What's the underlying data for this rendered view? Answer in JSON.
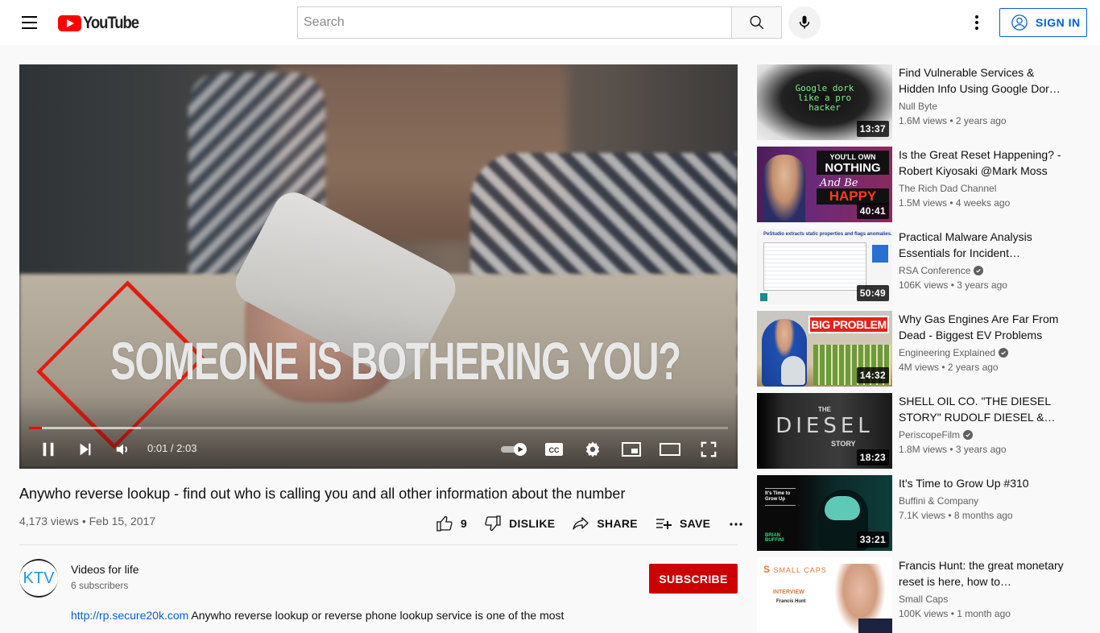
{
  "header": {
    "logo_text": "YouTube",
    "search_placeholder": "Search",
    "signin_label": "SIGN IN",
    "icons": [
      "menu-icon",
      "search-icon",
      "microphone-icon",
      "more-vert-icon",
      "account-circle-icon"
    ]
  },
  "player": {
    "overlay_text": "SOMEONE IS BOTHERING YOU?",
    "current_time": "0:01",
    "duration": "2:03",
    "time_display": "0:01 / 2:03",
    "progress_played_fraction": 0.008,
    "progress_loaded_fraction": 0.16,
    "autoplay_on": true,
    "icons": [
      "pause-icon",
      "next-icon",
      "volume-icon",
      "autoplay-toggle-icon",
      "captions-icon",
      "settings-icon",
      "miniplayer-icon",
      "theater-icon",
      "fullscreen-icon"
    ]
  },
  "video": {
    "title": "Anywho reverse lookup - find out who is calling you and all other information about the number",
    "views": "4,173 views",
    "date": "Feb 15, 2017",
    "meta": "4,173 views • Feb 15, 2017",
    "actions": {
      "like_count": "9",
      "dislike_label": "DISLIKE",
      "share_label": "SHARE",
      "save_label": "SAVE"
    }
  },
  "channel": {
    "avatar_text": "KTV",
    "name": "Videos for life",
    "subscribers": "6 subscribers",
    "subscribe_label": "SUBSCRIBE"
  },
  "description": {
    "link": "http://rp.secure20k.com",
    "text": " Anywho reverse lookup or reverse phone lookup service is one of the most"
  },
  "colors": {
    "brand_red": "#ff0000",
    "subscribe_red": "#cc0000",
    "link_blue": "#065fd4",
    "secondary_text": "#606060"
  },
  "recommendations": [
    {
      "title": "Find Vulnerable Services & Hidden Info Using Google Dor…",
      "channel": "Null Byte",
      "verified": false,
      "meta": "1.6M views • 2 years ago",
      "duration": "13:37",
      "thumb_text": "Google dork like a pro hacker"
    },
    {
      "title": "Is the Great Reset Happening? - Robert Kiyosaki @Mark Moss",
      "channel": "The Rich Dad Channel",
      "verified": false,
      "meta": "1.5M views • 4 weeks ago",
      "duration": "40:41",
      "thumb_text_1": "YOU'LL OWN",
      "thumb_text_2": "NOTHING",
      "thumb_text_3": "And Be",
      "thumb_text_4": "HAPPY"
    },
    {
      "title": "Practical Malware Analysis Essentials for Incident…",
      "channel": "RSA Conference",
      "verified": true,
      "meta": "106K views • 3 years ago",
      "duration": "50:49",
      "thumb_text": "PeStudio extracts static properties and flags anomalies."
    },
    {
      "title": "Why Gas Engines Are Far From Dead - Biggest EV Problems",
      "channel": "Engineering Explained",
      "verified": true,
      "meta": "4M views • 2 years ago",
      "duration": "14:32",
      "thumb_text": "BIG PROBLEM"
    },
    {
      "title": "SHELL OIL CO. \"THE DIESEL STORY\" RUDOLF DIESEL &…",
      "channel": "PeriscopeFilm",
      "verified": true,
      "meta": "1.8M views • 3 years ago",
      "duration": "18:23",
      "thumb_text_1": "THE",
      "thumb_text_2": "DIESEL",
      "thumb_text_3": "STORY"
    },
    {
      "title": "It’s Time to Grow Up #310",
      "channel": "Buffini & Company",
      "verified": false,
      "meta": "7.1K views • 8 months ago",
      "duration": "33:21",
      "thumb_text_1": "It's Time to Grow Up",
      "thumb_text_2": "BRIAN BUFFINI"
    },
    {
      "title": "Francis Hunt: the great monetary reset is here, how to…",
      "channel": "Small Caps",
      "verified": false,
      "meta": "100K views • 1 month ago",
      "duration": "",
      "thumb_text_1": "SMALL CAPS",
      "thumb_text_2": "INTERVIEW",
      "thumb_text_3": "Francis Hunt"
    }
  ]
}
